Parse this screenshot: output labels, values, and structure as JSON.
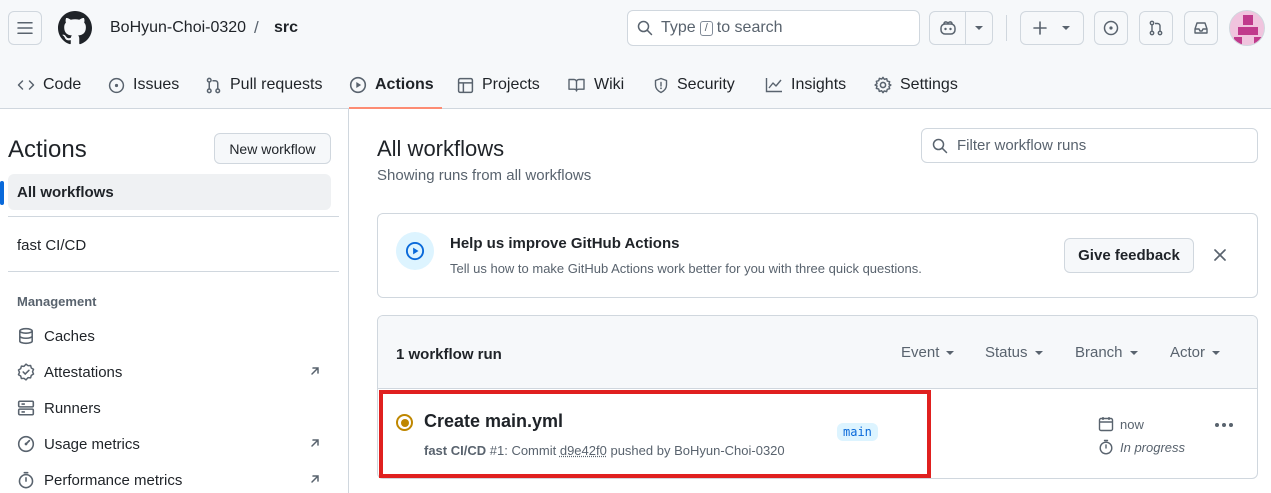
{
  "header": {
    "owner": "BoHyun-Choi-0320",
    "separator": "/",
    "repo": "src",
    "search": {
      "prefix": "Type",
      "key": "/",
      "suffix": "to search"
    }
  },
  "tabs": [
    {
      "label": "Code",
      "icon": "code-icon"
    },
    {
      "label": "Issues",
      "icon": "issue-opened-icon"
    },
    {
      "label": "Pull requests",
      "icon": "git-pull-request-icon"
    },
    {
      "label": "Actions",
      "icon": "play-icon",
      "active": true
    },
    {
      "label": "Projects",
      "icon": "table-icon"
    },
    {
      "label": "Wiki",
      "icon": "book-icon"
    },
    {
      "label": "Security",
      "icon": "shield-icon"
    },
    {
      "label": "Insights",
      "icon": "graph-icon"
    },
    {
      "label": "Settings",
      "icon": "gear-icon"
    }
  ],
  "sidebar": {
    "title": "Actions",
    "new_workflow": "New workflow",
    "all_workflows": "All workflows",
    "workflows": [
      "fast CI/CD"
    ],
    "management_label": "Management",
    "management": [
      {
        "label": "Caches",
        "icon": "database-icon",
        "external": false
      },
      {
        "label": "Attestations",
        "icon": "verified-icon",
        "external": true
      },
      {
        "label": "Runners",
        "icon": "server-icon",
        "external": false
      },
      {
        "label": "Usage metrics",
        "icon": "meter-icon",
        "external": true
      },
      {
        "label": "Performance metrics",
        "icon": "stopwatch-icon",
        "external": true
      }
    ]
  },
  "main": {
    "title": "All workflows",
    "subtitle": "Showing runs from all workflows",
    "filter_placeholder": "Filter workflow runs",
    "banner": {
      "title": "Help us improve GitHub Actions",
      "description": "Tell us how to make GitHub Actions work better for you with three quick questions.",
      "button": "Give feedback"
    },
    "runs": {
      "count_label": "1 workflow run",
      "filters": [
        "Event",
        "Status",
        "Branch",
        "Actor"
      ],
      "items": [
        {
          "title": "Create main.yml",
          "workflow": "fast CI/CD",
          "run_number": "#1",
          "meta_mid": ": Commit",
          "sha": "d9e42f0",
          "meta_tail": "pushed by BoHyun-Choi-0320",
          "branch": "main",
          "when": "now",
          "status": "In progress",
          "status_color": "#bf8700"
        }
      ]
    }
  },
  "colors": {
    "accent": "#0969da",
    "tab_underline": "#fd8c73",
    "highlight": "#e0201f"
  }
}
